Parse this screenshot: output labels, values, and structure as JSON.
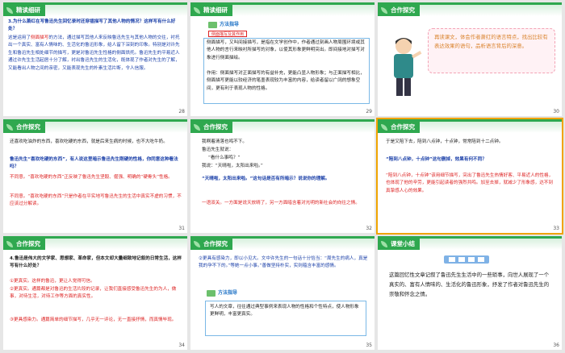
{
  "colors": {
    "header": "#2fa84f",
    "text_red": "#d22",
    "text_blue": "#1a3fa8",
    "selection": "#f0a400"
  },
  "slides": [
    {
      "number": "28",
      "header": "精读细研",
      "question": "3.为什么萧红在写鲁迅先生回忆录时还穿插描写了其他人物的情况？这样写有什么好处？",
      "answer_pre": "这是运用了",
      "answer_term": "侧面描写",
      "answer_post": "的方法，通过描写其他人来反映鲁迅先生与其他人物的交往，衬托出一个真实、富有人情味的、生活化的鲁迅形象，给人留下深刻的印象。特别是对许先生和鲁迅先生相处细节的描写，更是对鲁迅先生性格的侧面烘托。鲁迅先生的平易近人通过许先生生活起居十分了解，衬出鲁迅先生的生活化，既体现了作者对先生的了解，又能看出人物之间的亲密，又能表现先生的朴素生活片断，令人信服。"
    },
    {
      "number": "29",
      "header": "精读细研",
      "method_label": "方法指导",
      "tag_label": "侧面描写及其作用",
      "p1": "侧面描写，又叫间接描写，是指在文学创作中，作者通过刻画人物周围环境或其他人物的言行来映衬所描写的对象，以使其形象更鲜明突出。即间接地对描写对象进行侧面描绘。",
      "p2": "作用：侧面描写对正面描写的有益补充，更能凸显人物形象；与正面描写相比，侧面描写更能以较经济的笔墨表现较为丰富的内容，给读者留以广阔的想象空间，更有利于表现人物的性格。"
    },
    {
      "number": "30",
      "header": "合作探究",
      "bubble": "再读课文，体会作者萧红的语言特点，找出比较有表达效果的语句，品析语言背后的深意。"
    },
    {
      "number": "31",
      "header": "合作探究",
      "p1": "还喜欢吃油炸的东西，喜欢吃硬的东西，就是后来生病的时候，也不大吃牛奶。",
      "p2": "鲁迅先生“喜欢吃硬的东西”，有人说这里暗示鲁迅先生刚硬的性格，你同意这种看法吗？",
      "p3": "不同意。“喜欢吃硬的东西”正反映了鲁迅先生坚毅、倔强、明确的“硬骨头”性格。",
      "p4": "不同意。“喜欢吃硬的东西”只是作者在平实地写鲁迅先生的生活中真实不虚的习惯，不应该过分解读。"
    },
    {
      "number": "32",
      "header": "合作探究",
      "lines": [
        "我啊着清落也鸣不下。",
        "鲁迅先生就说：",
        "“看什么事鸣？”",
        "我说：“天晴啦，太阳出来啦。”"
      ],
      "q": "“天晴啦，太阳出来啦。”这句话是否有所暗示？说说你的理解。",
      "a": "一语双关。一方面是说天放晴了，另一方面暗含着对光明的新社会的向往之情。"
    },
    {
      "number": "33",
      "header": "合作探究",
      "p1": "于是又陪下去，陪到八点钟，十点钟，常常陪到十二点钟。",
      "q": "“陪到八点钟，十点钟”这句删掉，效果有何不同？",
      "a": "“陪到八点钟，十点钟”该用细节描写，突出了鲁迅先生热情好客、平易近人的性格，也体现了他的辛劳，更能引起读者的强烈共鸣。加至去掉，就减少了形象感，达不到真挚感人心的效果。"
    },
    {
      "number": "34",
      "header": "合作探究",
      "q": "4.鲁迅是伟大的文学家、思想家、革命家，但本文却大量细致地记叙的日常生活，这样写有什么好处？",
      "a1": "①更真实。这样的鲁迅，更让人觉得可信。",
      "a2": "②更真实。通篇都是对鲁迅的生活片段的记录，让我们直接感受鲁迅先生的为人，做事，对待生活，对待工作等方面的真实性。",
      "a3": "③更具感染力。通篇简单的细节描写，几乎无一评论，无一直接抒情，而真情毕现。"
    },
    {
      "number": "35",
      "header": "合作探究",
      "p1": "②更具有感染力，即以小见大。文中许先生的一句话十分恰当：“周先生的病人，真是我的孕不下的。”等她一点小事。”善做坚持朴实，实则蕴含丰富的感情。",
      "method_label": "方法指导",
      "p2": "写人的文章，往往通过典型事例来表现人物的性格和个性特点，使人物形象更鲜明，丰富更真实。"
    },
    {
      "number": "36",
      "header": "课堂小结",
      "summary": "这篇回忆性文章记叙了鲁迅先生生活中的一些琐事，向世人展现了一个真实的、富有人情味的、生活化的鲁迅形象，抒发了作者对鲁迅先生的崇敬和怀念之情。"
    }
  ]
}
